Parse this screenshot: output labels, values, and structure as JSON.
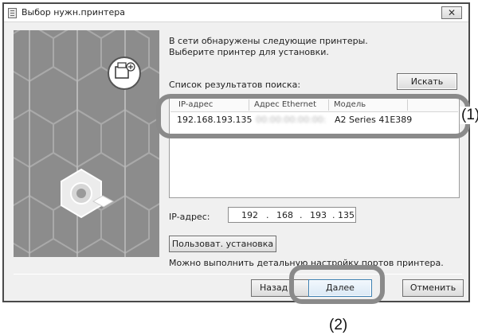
{
  "window": {
    "title": "Выбор нужн.принтера",
    "close_glyph": "✕",
    "app_icon": "printer-app-icon"
  },
  "main": {
    "description_line1": "В сети обнаружены следующие принтеры.",
    "description_line2": "Выберите принтер для установки.",
    "search_results_label": "Список результатов поиска:",
    "search_button": "Искать",
    "columns": [
      "IP-адрес",
      "Адрес Ethernet",
      "Модель"
    ],
    "printers": [
      {
        "ip": "192.168.193.135",
        "ethernet": "00:00:00:00:00:",
        "model": "A2 Series 41E389"
      }
    ],
    "ip_label": "IP-адрес:",
    "ip_octets": [
      "192",
      "168",
      "193",
      "135"
    ],
    "ip_dot": ".",
    "custom_button": "Пользоват. установка",
    "hint": "Можно выполнить детальную настройку портов принтера."
  },
  "footer": {
    "back_button": "Назад",
    "next_button": "Далее",
    "cancel_button": "Отменить"
  },
  "callouts": {
    "label_1": "(1)",
    "label_2": "(2)"
  },
  "colors": {
    "callout_ring": "#8a8a8a",
    "banner_bg": "#8c8c8c",
    "next_button_border": "#3c7fb1"
  }
}
